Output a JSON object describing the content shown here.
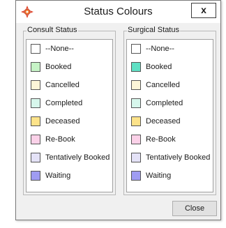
{
  "window": {
    "title": "Status Colours",
    "close_icon_glyph": "x"
  },
  "consult": {
    "title": "Consult Status",
    "items": [
      {
        "label": "--None--",
        "color": "#ffffff"
      },
      {
        "label": "Booked",
        "color": "#c6f3c6"
      },
      {
        "label": "Cancelled",
        "color": "#fdf6d8"
      },
      {
        "label": "Completed",
        "color": "#d7f7ec"
      },
      {
        "label": "Deceased",
        "color": "#fde38a"
      },
      {
        "label": "Re-Book",
        "color": "#fbd1e8"
      },
      {
        "label": "Tentatively Booked",
        "color": "#e4e2f7"
      },
      {
        "label": "Waiting",
        "color": "#9f9cf2"
      }
    ]
  },
  "surgical": {
    "title": "Surgical Status",
    "items": [
      {
        "label": "--None--",
        "color": "#ffffff"
      },
      {
        "label": "Booked",
        "color": "#5fe0c4"
      },
      {
        "label": "Cancelled",
        "color": "#fdf6d8"
      },
      {
        "label": "Completed",
        "color": "#d7f7ec"
      },
      {
        "label": "Deceased",
        "color": "#fde38a"
      },
      {
        "label": "Re-Book",
        "color": "#fbd1e8"
      },
      {
        "label": "Tentatively Booked",
        "color": "#e4e2f7"
      },
      {
        "label": "Waiting",
        "color": "#9f9cf2"
      }
    ]
  },
  "footer": {
    "close_label": "Close"
  }
}
